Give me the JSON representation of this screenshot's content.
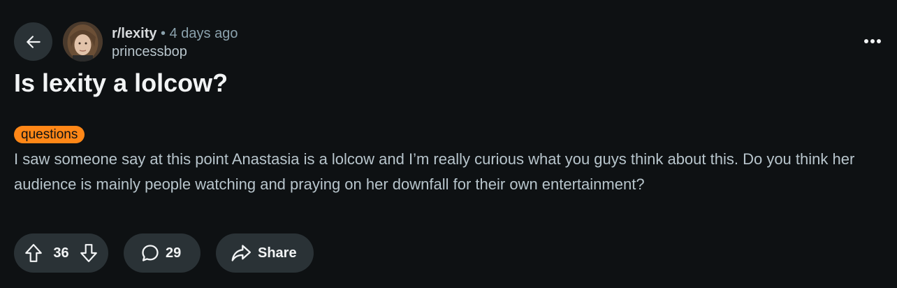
{
  "post": {
    "subreddit": "r/lexity",
    "separator": "•",
    "time_ago": "4 days ago",
    "author": "princessbop",
    "title": "Is lexity a lolcow?",
    "flair": "questions",
    "body": "I saw someone say at this point Anastasia is a lolcow and I’m really curious what you guys think about this. Do you think her audience is mainly people watching and praying on her downfall for their own entertainment?"
  },
  "actions": {
    "votes": "36",
    "comments": "29",
    "share_label": "Share"
  },
  "icons": {
    "back": "arrow-left-icon",
    "more": "more-horizontal-icon",
    "upvote": "upvote-arrow-icon",
    "downvote": "downvote-arrow-icon",
    "comment": "comment-bubble-icon",
    "share": "share-arrow-icon"
  },
  "colors": {
    "background": "#0e1113",
    "button_bg": "#2a3236",
    "flair_bg": "#ff8717",
    "title": "#f2f4f5",
    "body_text": "#b8c5cc",
    "muted": "#8ba2ad"
  }
}
